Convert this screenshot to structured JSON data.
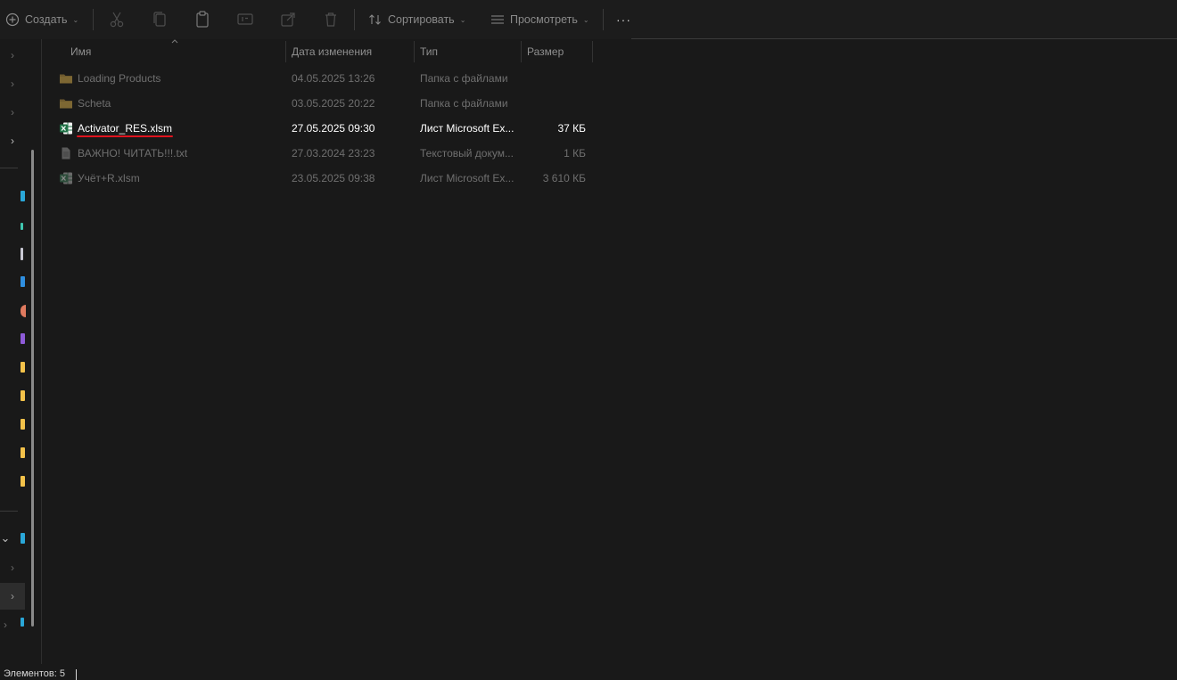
{
  "toolbar": {
    "create_label": "Создать",
    "sort_label": "Сортировать",
    "view_label": "Просмотреть",
    "more_label": "···"
  },
  "columns": {
    "name": "Имя",
    "date": "Дата изменения",
    "type": "Тип",
    "size": "Размер"
  },
  "files": [
    {
      "name": "Loading Products",
      "date": "04.05.2025 13:26",
      "type": "Папка с файлами",
      "size": "",
      "icon": "folder-icon",
      "state": "dim"
    },
    {
      "name": "Scheta",
      "date": "03.05.2025 20:22",
      "type": "Папка с файлами",
      "size": "",
      "icon": "folder-icon",
      "state": "dim"
    },
    {
      "name": "Activator_RES.xlsm",
      "date": "27.05.2025 09:30",
      "type": "Лист Microsoft Ex...",
      "size": "37 КБ",
      "icon": "excel-icon",
      "state": "active"
    },
    {
      "name": "ВАЖНО! ЧИТАТЬ!!!.txt",
      "date": "27.03.2024 23:23",
      "type": "Текстовый докум...",
      "size": "1 КБ",
      "icon": "text-file-icon",
      "state": "dim"
    },
    {
      "name": "Учёт+R.xlsm",
      "date": "23.05.2025 09:38",
      "type": "Лист Microsoft Ex...",
      "size": "3 610 КБ",
      "icon": "excel-icon",
      "state": "dim"
    }
  ],
  "status": {
    "items_count": "Элементов: 5"
  },
  "colors": {
    "background": "#191919",
    "accent_underline": "#e0141e"
  }
}
